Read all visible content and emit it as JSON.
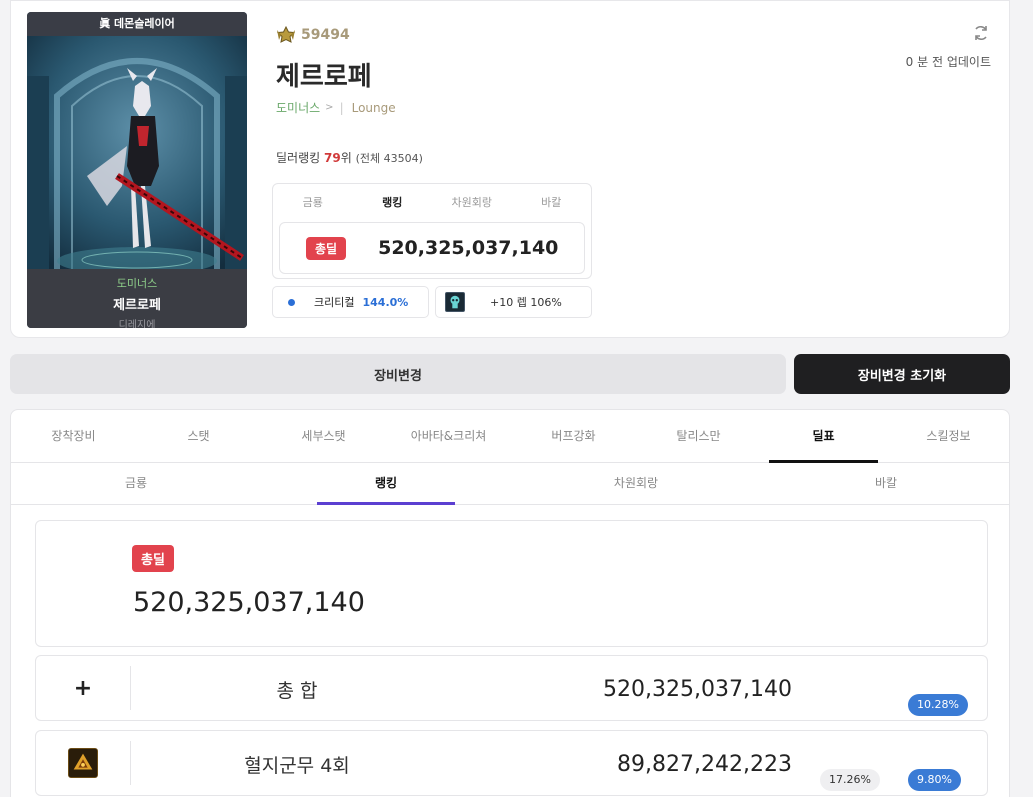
{
  "profile": {
    "title_banner": "眞 데몬슬레이어",
    "art_job": "도미너스",
    "art_name": "제르로페",
    "art_server": "디레지에",
    "fame": "59494",
    "name": "제르로페",
    "job": "도미너스",
    "lounge": "Lounge",
    "rank_prefix": "딜러랭킹",
    "rank_num": "79",
    "rank_suffix": "위",
    "rank_total": "(전체 43504)",
    "update_text": "0 분 전 업데이트"
  },
  "mini": {
    "tabs": [
      "금룡",
      "랭킹",
      "차원회랑",
      "바칼"
    ],
    "badge": "총딜",
    "value": "520,325,037,140",
    "crit_label": "크리티컬",
    "crit_value": "144.0%",
    "item_text": "+10 렙 106%"
  },
  "buttons": {
    "change": "장비변경",
    "reset": "장비변경 초기화"
  },
  "tabs": [
    "장착장비",
    "스탯",
    "세부스탯",
    "아바타&크리쳐",
    "버프강화",
    "탈리스만",
    "딜표",
    "스킬정보"
  ],
  "subtabs": [
    "금룡",
    "랭킹",
    "차원회랑",
    "바칼"
  ],
  "total": {
    "badge": "총딜",
    "value": "520,325,037,140"
  },
  "rows": [
    {
      "label": "총 합",
      "value": "520,325,037,140",
      "pill_blue": "10.28%",
      "pill_gray": ""
    },
    {
      "label": "혈지군무 4회",
      "value": "89,827,242,223",
      "pill_blue": "9.80%",
      "pill_gray": "17.26%"
    }
  ],
  "colors": {
    "badge_red": "#e2434d",
    "pill_blue": "#3a7bd5",
    "subtab_underline": "#5b3fd1",
    "crit_blue": "#2b6fd6"
  }
}
